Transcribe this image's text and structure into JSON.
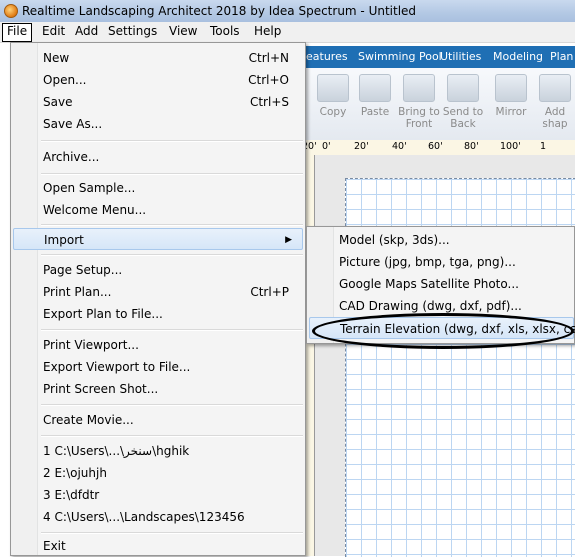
{
  "window": {
    "title": "Realtime Landscaping Architect 2018 by Idea Spectrum - Untitled"
  },
  "menubar": [
    "File",
    "Edit",
    "Add",
    "Settings",
    "View",
    "Tools",
    "Help"
  ],
  "ribbon_tabs": [
    "eatures",
    "Swimming Pool",
    "Utilities",
    "Modeling",
    "Plan"
  ],
  "ribbon_buttons": [
    {
      "label": "Copy"
    },
    {
      "label": "Paste"
    },
    {
      "label": "Bring to Front"
    },
    {
      "label": "Send to Back"
    },
    {
      "label": "Mirror"
    },
    {
      "label": "Add shap"
    }
  ],
  "ruler_ticks": [
    "20'",
    "0'",
    "20'",
    "40'",
    "60'",
    "80'",
    "100'",
    "1"
  ],
  "file_menu": {
    "new": {
      "label": "New",
      "shortcut": "Ctrl+N"
    },
    "open": {
      "label": "Open...",
      "shortcut": "Ctrl+O"
    },
    "save": {
      "label": "Save",
      "shortcut": "Ctrl+S"
    },
    "save_as": {
      "label": "Save As..."
    },
    "archive": {
      "label": "Archive..."
    },
    "open_sample": {
      "label": "Open Sample..."
    },
    "welcome_menu": {
      "label": "Welcome Menu..."
    },
    "import": {
      "label": "Import"
    },
    "page_setup": {
      "label": "Page Setup..."
    },
    "print_plan": {
      "label": "Print Plan...",
      "shortcut": "Ctrl+P"
    },
    "export_plan": {
      "label": "Export Plan to File..."
    },
    "print_viewport": {
      "label": "Print Viewport..."
    },
    "export_viewport": {
      "label": "Export Viewport to File..."
    },
    "print_screenshot": {
      "label": "Print Screen Shot..."
    },
    "create_movie": {
      "label": "Create Movie..."
    },
    "recent": [
      "1 C:\\Users\\...\\سنخر\\hghik",
      "2 E:\\ojuhjh",
      "3 E:\\dfdtr",
      "4 C:\\Users\\...\\Landscapes\\123456"
    ],
    "exit": {
      "label": "Exit"
    }
  },
  "import_submenu": [
    "Model (skp, 3ds)...",
    "Picture (jpg, bmp, tga, png)...",
    "Google Maps Satellite Photo...",
    "CAD Drawing (dwg, dxf, pdf)...",
    "Terrain Elevation (dwg, dxf, xls, xlsx, csv)..."
  ]
}
